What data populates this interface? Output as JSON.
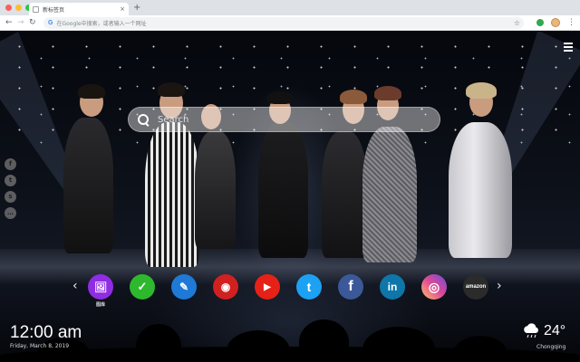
{
  "browser": {
    "tab_title": "新标签页",
    "close_glyph": "×",
    "new_tab_glyph": "+",
    "back_glyph": "←",
    "forward_glyph": "→",
    "reload_glyph": "↻",
    "omnibox_placeholder": "在Google中搜索，或者输入一个网址",
    "bookmark_glyph": "☆",
    "menu_glyph": "⋮",
    "window_dot_colors": [
      "#ff5f57",
      "#ffbd2e",
      "#28c940"
    ]
  },
  "search": {
    "placeholder": "Search",
    "icon": "search-icon"
  },
  "side_social": [
    {
      "name": "facebook-icon",
      "glyph": "f"
    },
    {
      "name": "twitter-icon",
      "glyph": "t"
    },
    {
      "name": "share-icon",
      "glyph": "s"
    },
    {
      "name": "feedback-icon",
      "glyph": "…"
    }
  ],
  "shortcuts": [
    {
      "name": "wallpaper-icon",
      "glyph": "🖼",
      "bg": "#8e2de2",
      "label": "图库"
    },
    {
      "name": "checklist-icon",
      "glyph": "✓",
      "bg": "#2eb82e",
      "label": ""
    },
    {
      "name": "notes-icon",
      "glyph": "✎",
      "bg": "#1e7ad6",
      "label": ""
    },
    {
      "name": "game-icon",
      "glyph": "◉",
      "bg": "#d12020",
      "label": ""
    },
    {
      "name": "youtube-icon",
      "glyph": "▶",
      "bg": "#e62117",
      "label": ""
    },
    {
      "name": "twitter-icon",
      "glyph": "t",
      "bg": "#1da1f2",
      "label": ""
    },
    {
      "name": "facebook-icon",
      "glyph": "f",
      "bg": "#3b5998",
      "label": ""
    },
    {
      "name": "linkedin-icon",
      "glyph": "in",
      "bg": "#0e76a8",
      "label": ""
    },
    {
      "name": "instagram-icon",
      "glyph": "◎",
      "bg": "#d6249f",
      "label": ""
    },
    {
      "name": "amazon-icon",
      "glyph": "amazon",
      "bg": "#2b2b2b",
      "label": ""
    }
  ],
  "arrows": {
    "prev": "‹",
    "next": "›"
  },
  "clock": {
    "time": "12:00 am",
    "date": "Friday, March 8, 2019"
  },
  "weather": {
    "temp": "24°",
    "city": "Chongqing",
    "icon": "cloud-rain-icon"
  }
}
